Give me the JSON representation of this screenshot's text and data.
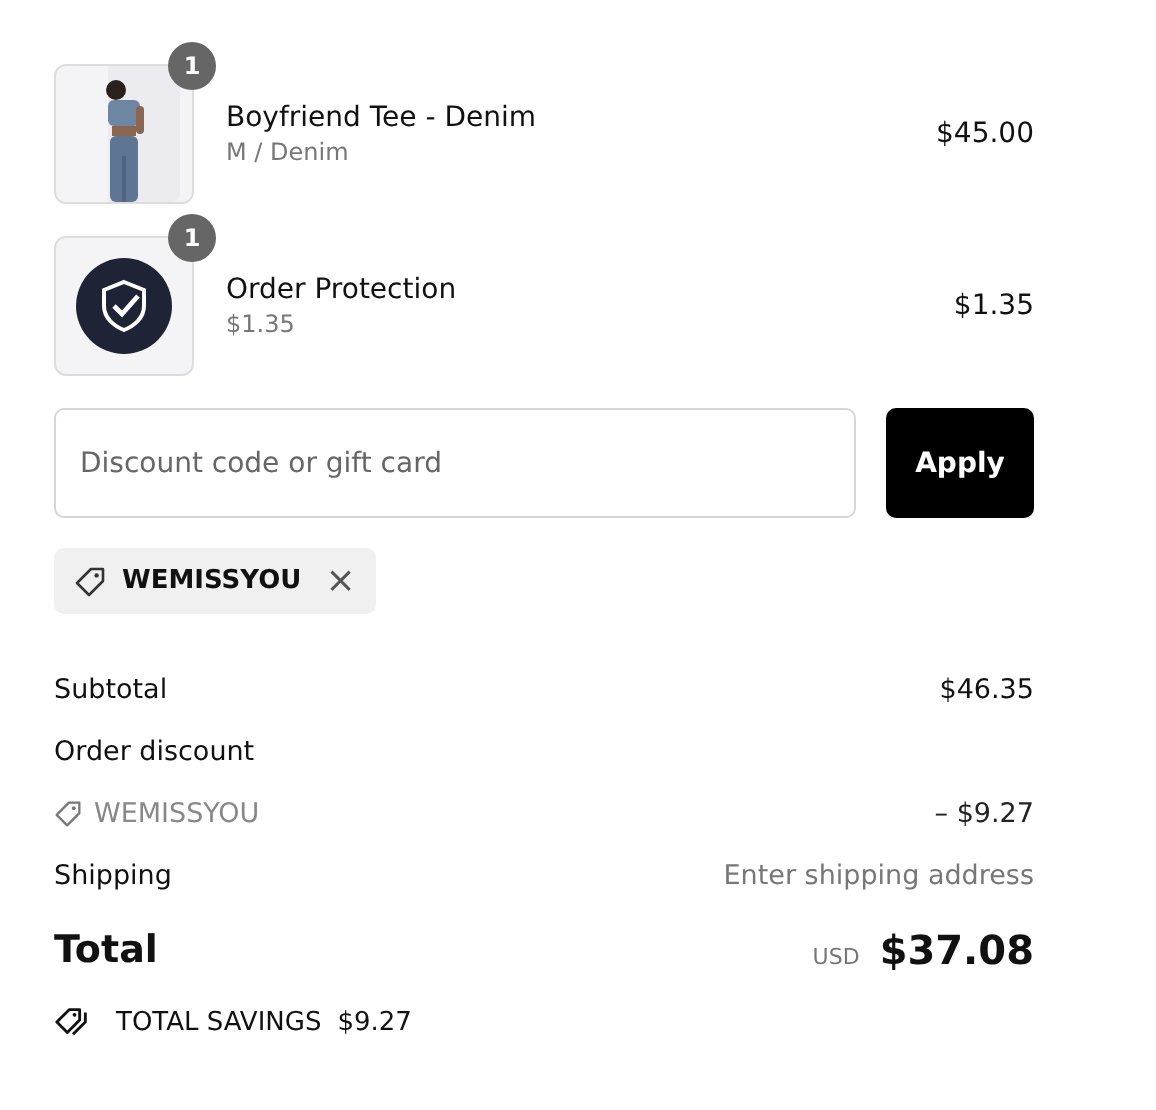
{
  "items": [
    {
      "kind": "picture",
      "quantity": "1",
      "name": "Boyfriend Tee - Denim",
      "variant": "M / Denim",
      "price": "$45.00"
    },
    {
      "kind": "shield",
      "quantity": "1",
      "name": "Order Protection",
      "variant": "$1.35",
      "price": "$1.35"
    }
  ],
  "discount": {
    "placeholder": "Discount code or gift card",
    "button": "Apply"
  },
  "applied_codes": [
    {
      "code": "WEMISSYOU",
      "remove": "×"
    }
  ],
  "summary": {
    "subtotal_label": "Subtotal",
    "subtotal": "$46.35",
    "discount_label": "Order discount",
    "discount_code": "WEMISSYOU",
    "discount_amount": "– $9.27",
    "shipping_label": "Shipping",
    "shipping": "Enter shipping address",
    "total_label": "Total",
    "currency": "USD",
    "total": "$37.08",
    "savings_label": "TOTAL SAVINGS",
    "savings": "$9.27"
  }
}
